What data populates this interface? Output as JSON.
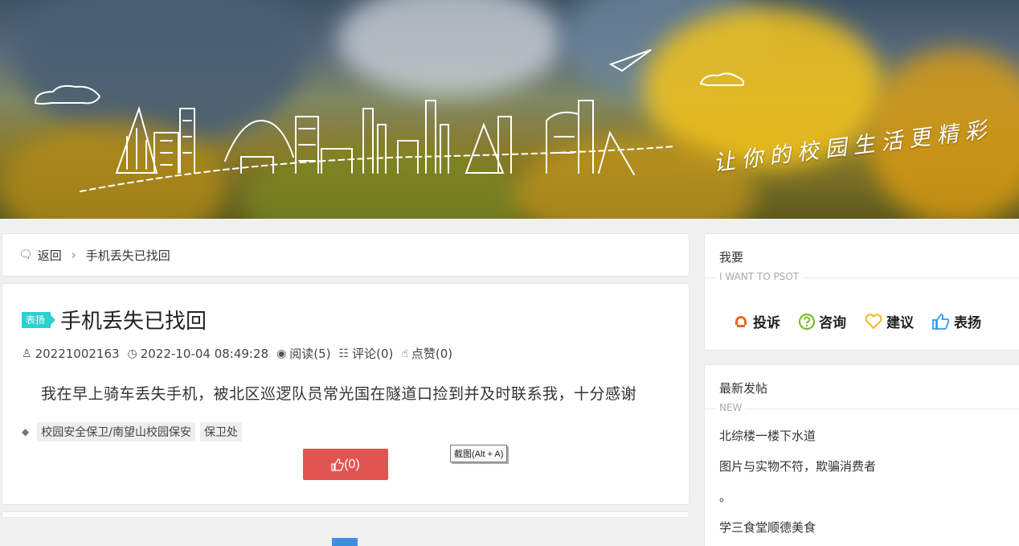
{
  "banner": {
    "slogan": "让你的校园生活更精彩"
  },
  "breadcrumb": {
    "back_label": "返回",
    "current": "手机丢失已找回"
  },
  "post": {
    "badge": "表扬",
    "title": "手机丢失已找回",
    "author": "20221002163",
    "datetime": "2022-10-04 08:49:28",
    "reads": "阅读(5)",
    "comments": "评论(0)",
    "likes": "点赞(0)",
    "content": "我在早上骑车丢失手机，被北区巡逻队员常光国在隧道口捡到并及时联系我，十分感谢",
    "tags": [
      "校园安全保卫/南望山校园保安",
      "保卫处"
    ],
    "like_button": "(0)"
  },
  "tooltip": "截图(Alt + A)",
  "sidebar": {
    "want": {
      "title": "我要",
      "subtitle": "I WANT TO PSOT",
      "actions": [
        {
          "label": "投诉",
          "icon": "complaint-icon",
          "color": "#e8682a"
        },
        {
          "label": "咨询",
          "icon": "question-icon",
          "color": "#7cb82f"
        },
        {
          "label": "建议",
          "icon": "heart-icon",
          "color": "#f2b81c"
        },
        {
          "label": "表扬",
          "icon": "thumbs-up-icon",
          "color": "#2a9ee8"
        }
      ]
    },
    "latest": {
      "title": "最新发帖",
      "subtitle": "NEW",
      "items": [
        "北综楼一楼下水道",
        "图片与实物不符，欺骗消费者",
        "。",
        "学三食堂顺德美食"
      ]
    }
  }
}
